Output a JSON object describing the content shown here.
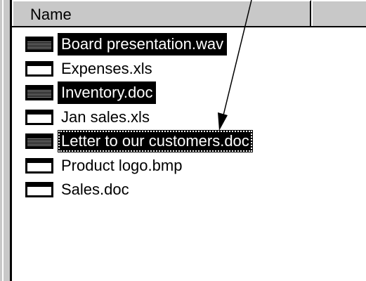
{
  "header": {
    "name_column": "Name",
    "second_column": ""
  },
  "files": [
    {
      "name": "Board presentation.wav",
      "selected": true,
      "focused": false
    },
    {
      "name": "Expenses.xls",
      "selected": false,
      "focused": false
    },
    {
      "name": "Inventory.doc",
      "selected": true,
      "focused": false
    },
    {
      "name": "Jan sales.xls",
      "selected": false,
      "focused": false
    },
    {
      "name": "Letter to our customers.doc",
      "selected": true,
      "focused": true
    },
    {
      "name": "Product logo.bmp",
      "selected": false,
      "focused": false
    },
    {
      "name": "Sales.doc",
      "selected": false,
      "focused": false
    }
  ],
  "colors": {
    "selection_background": "#000000",
    "selection_text": "#ffffff",
    "chrome_gray": "#c8c8c8"
  },
  "annotation": {
    "type": "arrow",
    "direction": "down-left"
  }
}
